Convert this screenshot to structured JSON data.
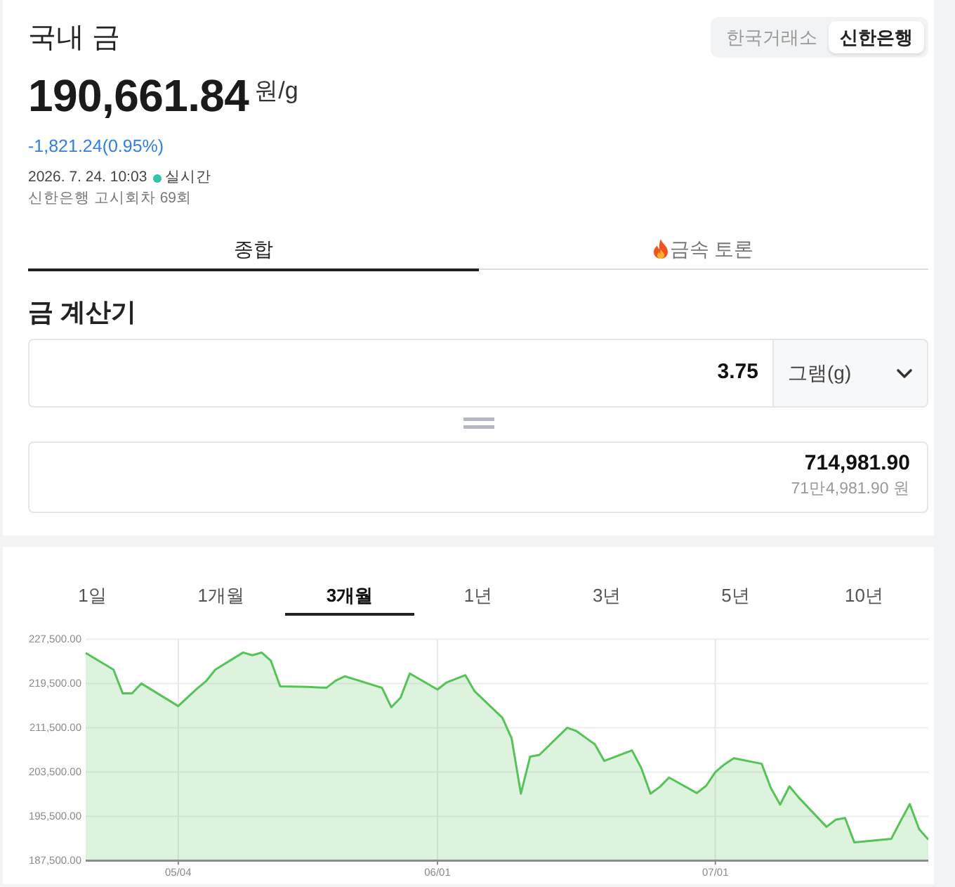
{
  "header": {
    "title": "국내 금",
    "source_toggle": [
      {
        "label": "한국거래소",
        "selected": false
      },
      {
        "label": "신한은행",
        "selected": true
      }
    ]
  },
  "price": {
    "value": "190,661.84",
    "unit": "원/g",
    "change": "-1,821.24(0.95%)"
  },
  "updated": {
    "time": "2026. 7. 24. 10:03",
    "live_label": "실시간"
  },
  "notice": "신한은행 고시회차 69회",
  "tabs": [
    {
      "label": "종합",
      "selected": true,
      "kind": "plain"
    },
    {
      "label": "금속 토론",
      "selected": false,
      "kind": "hot"
    }
  ],
  "calculator": {
    "title": "금 계산기",
    "amount": "3.75",
    "unit": "그램(g)",
    "result": "714,981.90",
    "result_words": "71만4,981.90 원"
  },
  "periods": [
    {
      "label": "1일",
      "selected": false
    },
    {
      "label": "1개월",
      "selected": false
    },
    {
      "label": "3개월",
      "selected": true
    },
    {
      "label": "1년",
      "selected": false
    },
    {
      "label": "3년",
      "selected": false
    },
    {
      "label": "5년",
      "selected": false
    },
    {
      "label": "10년",
      "selected": false
    }
  ],
  "chart": {
    "chart_data": {
      "type": "area",
      "x": [
        "2026-04-24",
        "2026-04-27",
        "2026-04-28",
        "2026-04-29",
        "2026-04-30",
        "2026-05-04",
        "2026-05-06",
        "2026-05-07",
        "2026-05-08",
        "2026-05-11",
        "2026-05-12",
        "2026-05-13",
        "2026-05-14",
        "2026-05-15",
        "2026-05-18",
        "2026-05-19",
        "2026-05-20",
        "2026-05-21",
        "2026-05-22",
        "2026-05-26",
        "2026-05-27",
        "2026-05-28",
        "2026-05-29",
        "2026-06-01",
        "2026-06-02",
        "2026-06-04",
        "2026-06-05",
        "2026-06-08",
        "2026-06-09",
        "2026-06-10",
        "2026-06-11",
        "2026-06-12",
        "2026-06-15",
        "2026-06-16",
        "2026-06-17",
        "2026-06-18",
        "2026-06-19",
        "2026-06-22",
        "2026-06-23",
        "2026-06-24",
        "2026-06-25",
        "2026-06-26",
        "2026-06-29",
        "2026-06-30",
        "2026-07-01",
        "2026-07-02",
        "2026-07-03",
        "2026-07-06",
        "2026-07-07",
        "2026-07-08",
        "2026-07-09",
        "2026-07-10",
        "2026-07-13",
        "2026-07-14",
        "2026-07-15",
        "2026-07-16",
        "2026-07-20",
        "2026-07-21",
        "2026-07-22",
        "2026-07-23",
        "2026-07-24"
      ],
      "series": [
        {
          "color": "#55c456",
          "values": [
            225000,
            222000,
            217700,
            217700,
            219500,
            215400,
            218500,
            219900,
            222000,
            225100,
            224600,
            225100,
            223600,
            219000,
            218900,
            218800,
            218700,
            220000,
            220800,
            218700,
            215200,
            216900,
            221300,
            218400,
            219700,
            221000,
            218100,
            213300,
            209600,
            199600,
            206300,
            206600,
            211500,
            210900,
            209700,
            208500,
            205500,
            207400,
            204200,
            199600,
            200800,
            202500,
            199700,
            201000,
            203500,
            204900,
            206000,
            205000,
            200600,
            197600,
            200900,
            198900,
            193600,
            194900,
            195200,
            190800,
            191400,
            194600,
            197700,
            193200,
            191300
          ]
        }
      ],
      "xlim": [
        "2026-04-24",
        "2026-07-24"
      ],
      "ylim": [
        187500,
        227500
      ],
      "xticks": [
        {
          "value": "2026-05-04",
          "label": "05/04"
        },
        {
          "value": "2026-06-01",
          "label": "06/01"
        },
        {
          "value": "2026-07-01",
          "label": "07/01"
        }
      ],
      "yticks": [
        {
          "value": 187500,
          "label": "187,500.00"
        },
        {
          "value": 195500,
          "label": "195,500.00"
        },
        {
          "value": 203500,
          "label": "203,500.00"
        },
        {
          "value": 211500,
          "label": "211,500.00"
        },
        {
          "value": 219500,
          "label": "219,500.00"
        },
        {
          "value": 227500,
          "label": "227,500.00"
        }
      ],
      "grid": true
    }
  }
}
